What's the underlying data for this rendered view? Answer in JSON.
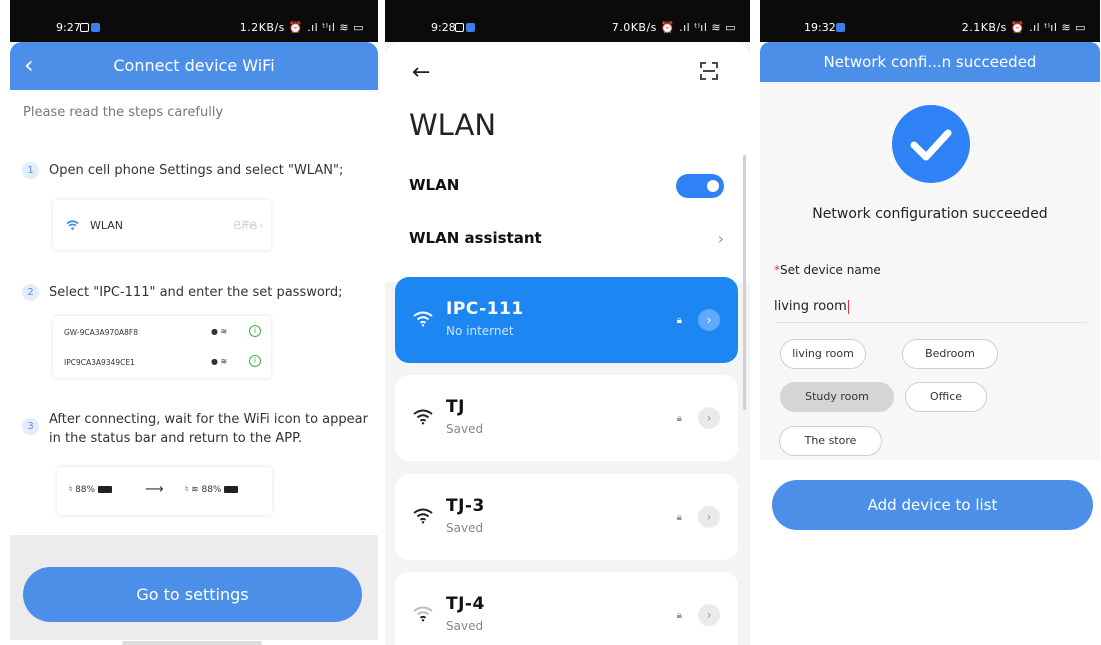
{
  "screen1": {
    "status": {
      "time": "9:27",
      "right": "1.2KB/s ⏰ .ıl ᵗˡıl ≋ ▭"
    },
    "title": "Connect device WiFi",
    "intro": "Please read the steps carefully",
    "steps": [
      {
        "num": "1",
        "text": "Open cell phone Settings and select \"WLAN\";"
      },
      {
        "num": "2",
        "text": "Select \"IPC-111\" and enter the set password;"
      },
      {
        "num": "3",
        "text": "After connecting, wait for the WiFi icon to appear in the status bar and return to the APP."
      }
    ],
    "wlan_card": {
      "label": "WLAN",
      "hint": "已开启 ›"
    },
    "networks": [
      {
        "name": "GW-9CA3A970A8F8",
        "icons": "● ≋"
      },
      {
        "name": "IPC9CA3A9349CE1",
        "icons": "● ≋"
      }
    ],
    "battery_before": "88%",
    "battery_after": "88%",
    "button": "Go to settings"
  },
  "screen2": {
    "status": {
      "time": "9:28",
      "right": "7.0KB/s ⏰ .ıl ᵗˡıl ≋ ▭"
    },
    "title": "WLAN",
    "wlan_label": "WLAN",
    "wlan_on": true,
    "assistant_label": "WLAN assistant",
    "networks": [
      {
        "name": "IPC-111",
        "status": "No internet",
        "active": true
      },
      {
        "name": "TJ",
        "status": "Saved",
        "active": false
      },
      {
        "name": "TJ-3",
        "status": "Saved",
        "active": false
      },
      {
        "name": "TJ-4",
        "status": "Saved",
        "active": false
      }
    ]
  },
  "screen3": {
    "status": {
      "time": "19:32",
      "right": "2.1KB/s ⏰ .ıl ᵗˡıl ≋ ▭"
    },
    "title": "Network confi...n succeeded",
    "success": "Network configuration succeeded",
    "label_required": "*",
    "label": "Set device name",
    "input_value": "living room",
    "tags": [
      {
        "label": "living room",
        "selected": false
      },
      {
        "label": "Bedroom",
        "selected": false
      },
      {
        "label": "Study room",
        "selected": true
      },
      {
        "label": "Office",
        "selected": false
      },
      {
        "label": "The store",
        "selected": false
      }
    ],
    "button": "Add device to list"
  },
  "colors": {
    "accent": "#4b8fe8",
    "wifi_active": "#1c86f2",
    "required": "#e33333"
  }
}
